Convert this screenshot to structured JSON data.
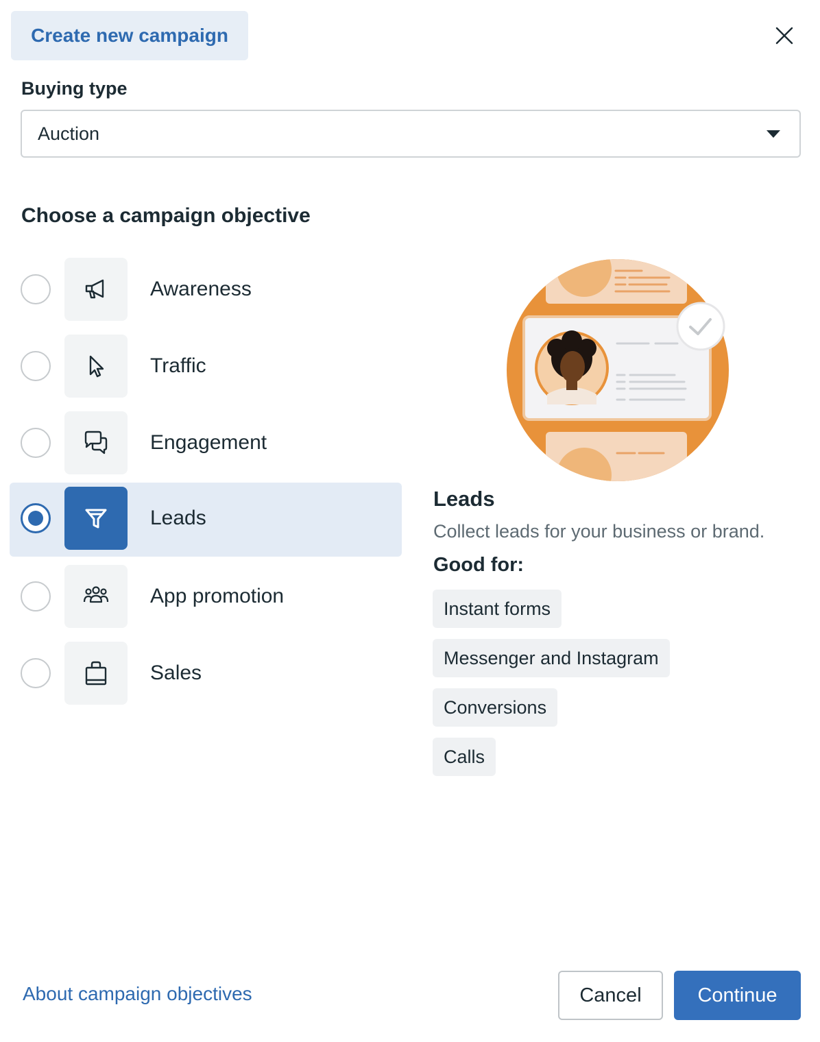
{
  "header": {
    "title": "Create new campaign",
    "close_icon": "close-icon"
  },
  "buying_type": {
    "label": "Buying type",
    "value": "Auction"
  },
  "objective": {
    "heading": "Choose a campaign objective",
    "selected": "Leads",
    "options": [
      {
        "label": "Awareness",
        "icon": "megaphone-icon"
      },
      {
        "label": "Traffic",
        "icon": "cursor-icon"
      },
      {
        "label": "Engagement",
        "icon": "chat-bubbles-icon"
      },
      {
        "label": "Leads",
        "icon": "funnel-icon"
      },
      {
        "label": "App promotion",
        "icon": "people-icon"
      },
      {
        "label": "Sales",
        "icon": "shopping-bag-icon"
      }
    ]
  },
  "detail": {
    "title": "Leads",
    "description": "Collect leads for your business or brand.",
    "good_for_label": "Good for:",
    "good_for": [
      "Instant forms",
      "Messenger and Instagram",
      "Conversions",
      "Calls"
    ]
  },
  "footer": {
    "link": "About campaign objectives",
    "cancel": "Cancel",
    "continue": "Continue"
  },
  "colors": {
    "accent": "#2e6ab0",
    "selected_bg": "#e3ebf5",
    "illustration_orange": "#e8923a"
  }
}
